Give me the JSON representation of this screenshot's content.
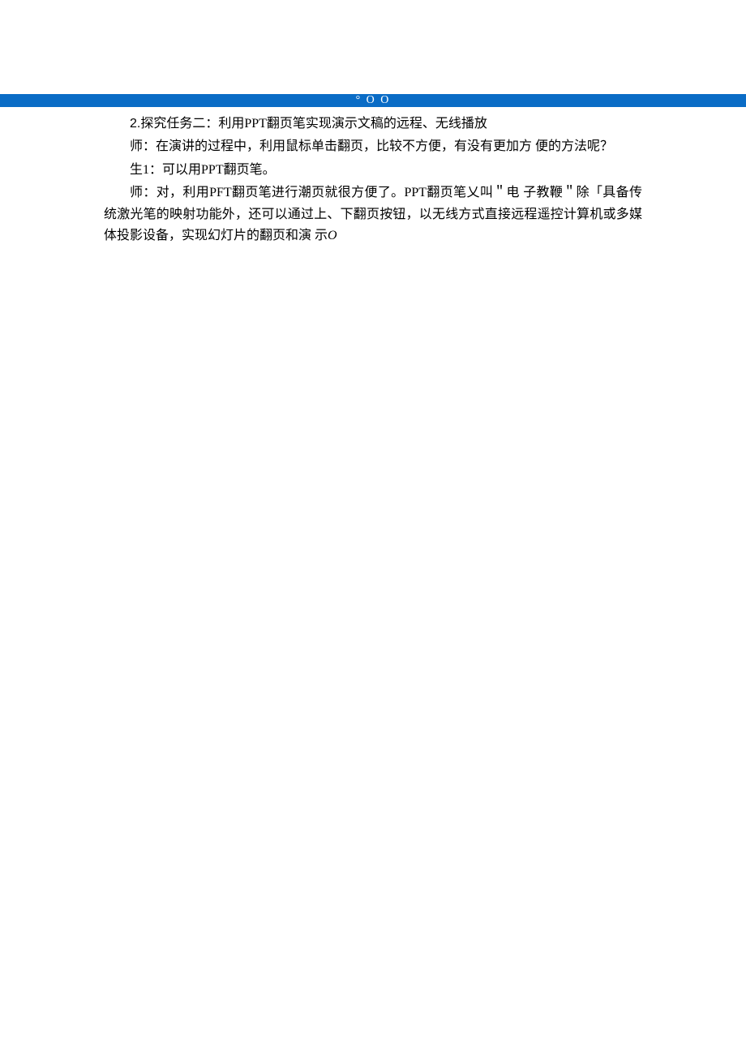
{
  "header": {
    "marks": "° O O"
  },
  "paragraphs": {
    "p1_prefix": "2.",
    "p1": "探究任务二：利用PPT翻页笔实现演示文稿的远程、无线播放",
    "p2": "师：在演讲的过程中，利用鼠标单击翻页，比较不方便，有没有更加方 便的方法呢？",
    "p3_prefix": "生1：",
    "p3": "可以用PPT翻页笔。",
    "p4": "师：对，利用PFT翻页笔进行潮页就很方便了。PPT翻页笔乂叫＂电 子教鞭＂除「具备传统激光笔的映射功能外，还可以通过上、下翻页按钮，以无线方式直接远程遥控计算机或多媒体投影设备，实现幻灯片的翻页和演 示",
    "p4_suffix": "O"
  }
}
